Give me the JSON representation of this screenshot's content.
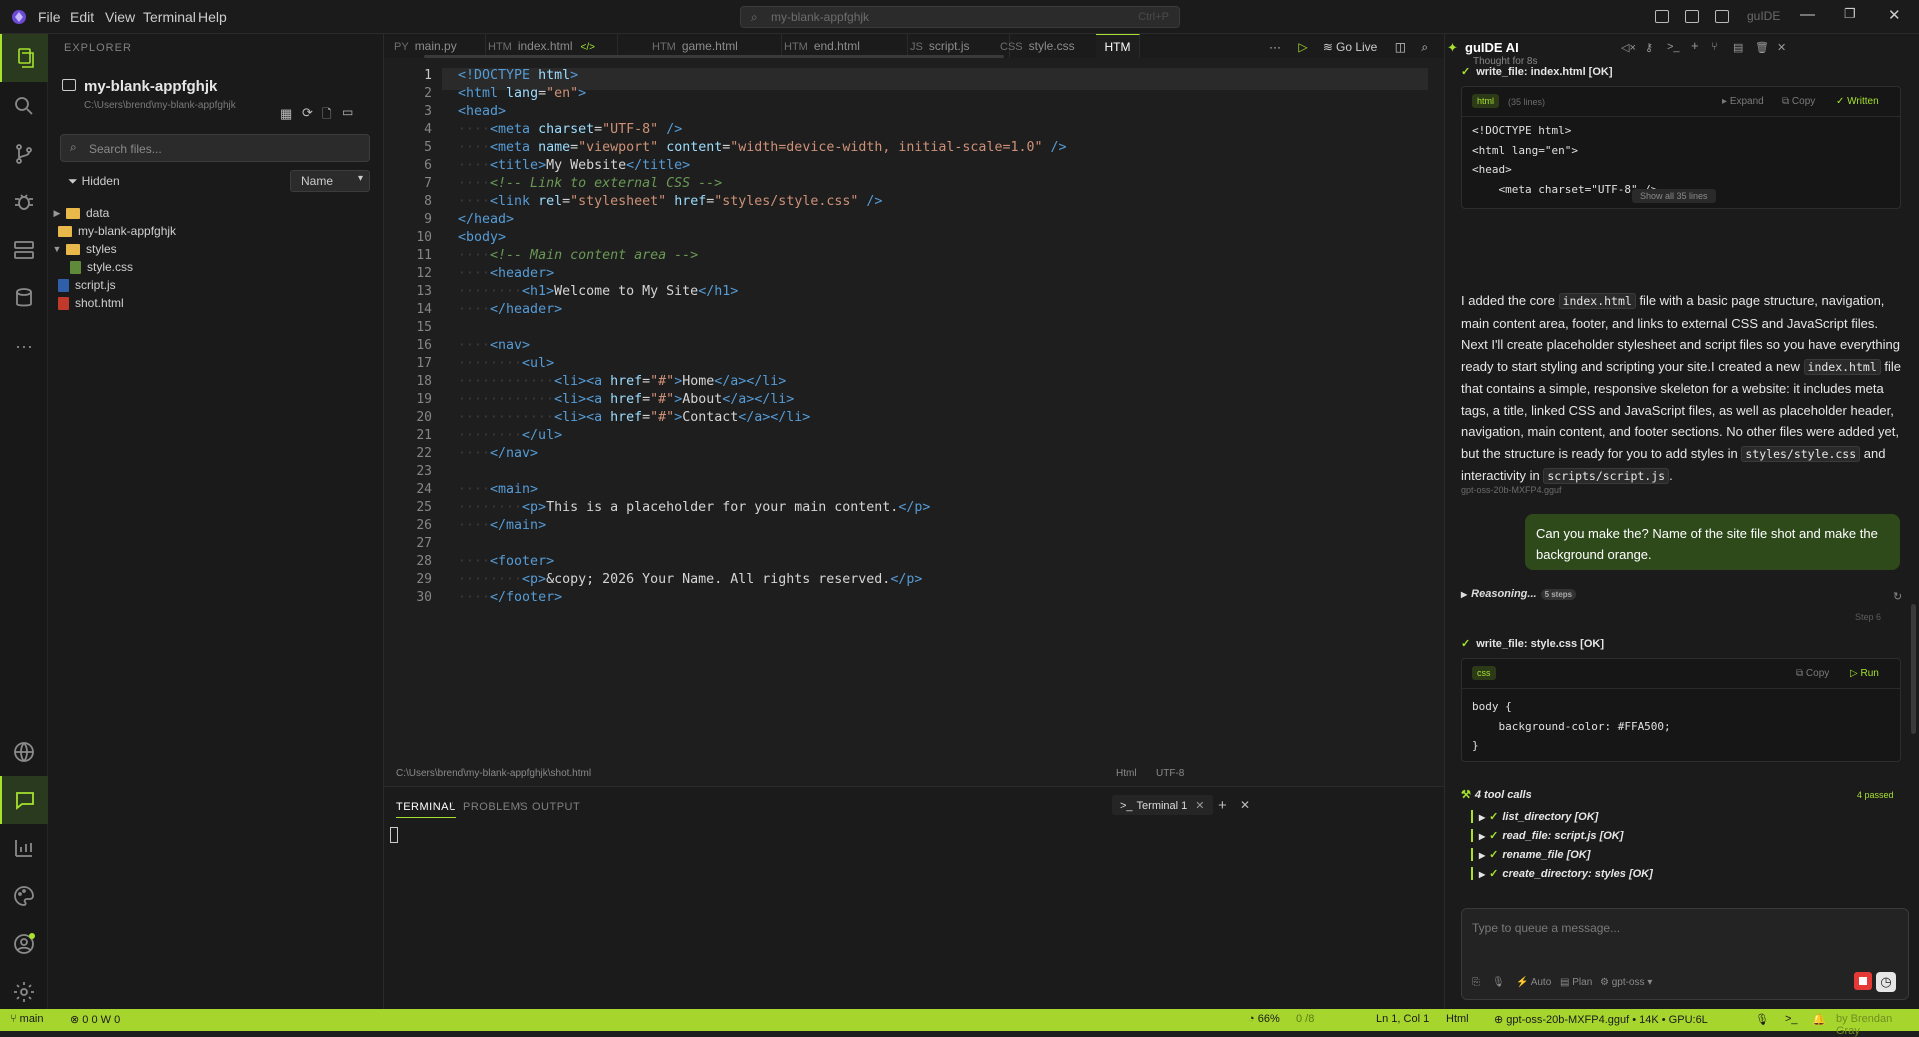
{
  "titlebar": {
    "menu": [
      "File",
      "Edit",
      "View",
      "Terminal",
      "Help"
    ],
    "search": "my-blank-appfghjk",
    "search_shortcut": "Ctrl+P",
    "brand": "guIDE"
  },
  "explorer": {
    "title": "EXPLORER",
    "project_name": "my-blank-appfghjk",
    "project_path": "C:\\Users\\brend\\my-blank-appfghjk",
    "search_placeholder": "Search files...",
    "hidden_label": "Hidden",
    "sort_value": "Name",
    "tree": [
      {
        "name": "data",
        "type": "folder",
        "depth": 0
      },
      {
        "name": "my-blank-appfghjk",
        "type": "folder",
        "depth": 0
      },
      {
        "name": "styles",
        "type": "folder",
        "depth": 0
      },
      {
        "name": "style.css",
        "type": "css",
        "depth": 1
      },
      {
        "name": "script.js",
        "type": "js",
        "depth": 0
      },
      {
        "name": "shot.html",
        "type": "html",
        "depth": 0
      }
    ]
  },
  "tabs": [
    {
      "prefix": "PY",
      "label": "main.py"
    },
    {
      "prefix": "HTM",
      "label": "index.html"
    },
    {
      "prefix": "HTM",
      "label": "game.html"
    },
    {
      "prefix": "HTM",
      "label": "end.html"
    },
    {
      "prefix": "JS",
      "label": "script.js"
    },
    {
      "prefix": "CSS",
      "label": "style.css"
    },
    {
      "prefix": "",
      "label": "HTM"
    }
  ],
  "tab_actions": {
    "more": "···",
    "go_live": "Go Live"
  },
  "editor": {
    "current_line": 1,
    "file_path": "C:\\Users\\brend\\my-blank-appfghjk\\shot.html",
    "language": "Html",
    "encoding": "UTF-8"
  },
  "panel": {
    "tabs": [
      "TERMINAL",
      "PROBLEMS",
      "OUTPUT"
    ],
    "terminal_tab": "Terminal 1"
  },
  "ai": {
    "title": "guIDE AI",
    "thought_label": "Thought for 8s",
    "tool1": "write_file: index.html [OK]",
    "card1": {
      "lang": "html",
      "lines": "(35 lines)",
      "expand": "Expand",
      "copy": "Copy",
      "status": "Written",
      "show_all": "Show all 35 lines"
    },
    "paragraph": "I added the core index.html file with a basic page structure, navigation, main content area, footer, and links to external CSS and JavaScript files. Next I'll create placeholder stylesheet and script files so you have everything ready to start styling and scripting your site.I created a new index.html file that contains a simple, responsive skeleton for a website: it includes meta tags, a title, linked CSS and JavaScript files, as well as placeholder header, navigation, main content, and footer sections. No other files were added yet, but the structure is ready for you to add styles in styles/style.css and interactivity in scripts/script.js.",
    "model_tag": "gpt-oss-20b-MXFP4.gguf",
    "user_message": "Can you make the? Name of the site file shot and make the background orange.",
    "reasoning_label": "Reasoning...",
    "reasoning_steps": "5 steps",
    "step_tag": "Step 6",
    "tool2": "write_file: style.css [OK]",
    "card2": {
      "lang": "css",
      "copy": "Copy",
      "run": "Run"
    },
    "tool_calls_title": "4 tool calls",
    "tool_calls_passed": "4 passed",
    "tool_calls": [
      "list_directory [OK]",
      "read_file: script.js [OK]",
      "rename_file [OK]",
      "create_directory: styles [OK]"
    ],
    "input_placeholder": "Type to queue a message...",
    "input_controls": {
      "auto": "Auto",
      "plan": "Plan",
      "model": "gpt-oss"
    }
  },
  "statusbar": {
    "branch": "main",
    "problems": "0 0  W 0",
    "usage": "66%",
    "tokens": "0 /8",
    "position": "Ln 1, Col 1",
    "language": "Html",
    "model_info": "gpt-oss-20b-MXFP4.gguf • 14K • GPU:6L",
    "credit": "by Brendan Gray"
  },
  "colors": {
    "accent": "#a6e22e",
    "statusbar": "#a6d62e",
    "user_bubble": "#2e4a1a"
  }
}
